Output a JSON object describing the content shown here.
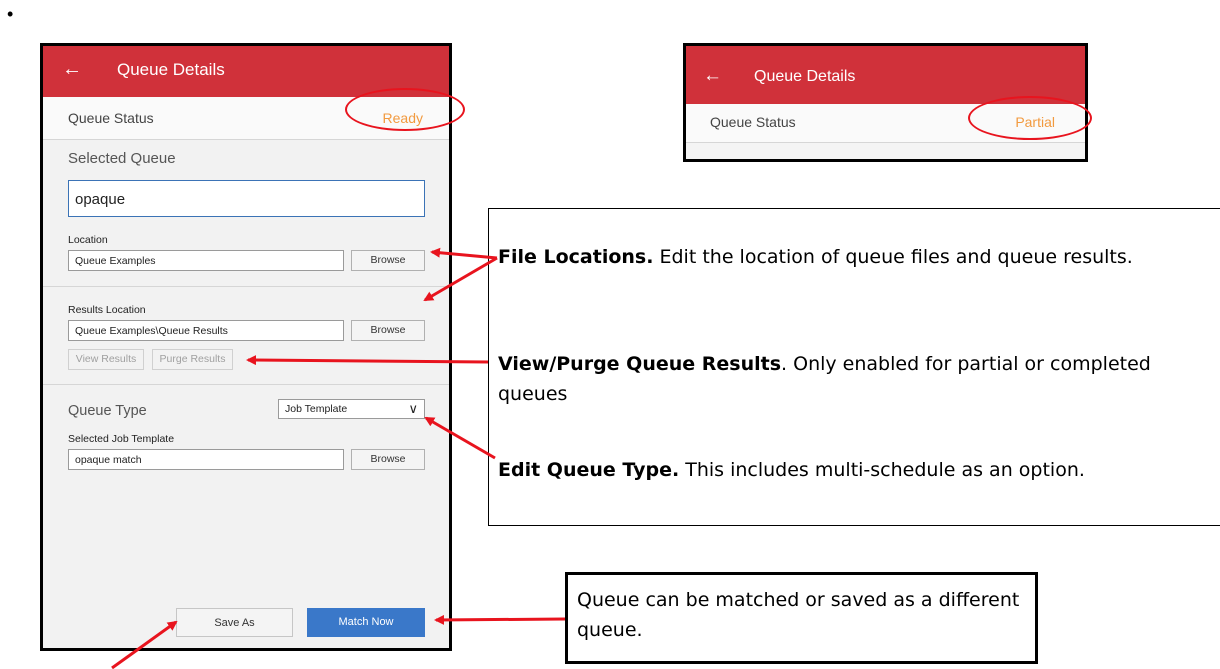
{
  "bullet": "•",
  "main_panel": {
    "header": {
      "back_icon": "arrow-left-icon",
      "back_glyph": "←",
      "title": "Queue Details"
    },
    "status": {
      "label": "Queue Status",
      "value": "Ready"
    },
    "selected_queue": {
      "label": "Selected Queue",
      "value": "opaque"
    },
    "location": {
      "label": "Location",
      "value": "Queue Examples",
      "browse": "Browse"
    },
    "results_location": {
      "label": "Results Location",
      "value": "Queue Examples\\Queue Results",
      "browse": "Browse"
    },
    "results_buttons": {
      "view": "View Results",
      "purge": "Purge Results"
    },
    "queue_type": {
      "label": "Queue Type",
      "selected": "Job Template",
      "chevron": "∨"
    },
    "job_template": {
      "label": "Selected Job Template",
      "value": "opaque match",
      "browse": "Browse"
    },
    "footer": {
      "save_as": "Save As",
      "match_now": "Match Now"
    }
  },
  "partial_panel": {
    "header": {
      "back_glyph": "←",
      "title": "Queue Details"
    },
    "status": {
      "label": "Queue Status",
      "value": "Partial"
    }
  },
  "callouts": {
    "file_locations": {
      "bold": "File Locations.",
      "text": "  Edit the location of queue files and queue results."
    },
    "view_purge": {
      "bold": "View/Purge Queue Results",
      "text": ". Only enabled for partial or completed queues"
    },
    "edit_type": {
      "bold": "Edit Queue Type.",
      "text": "  This includes multi-schedule as an option."
    },
    "match_save": {
      "text": "Queue can be matched or saved as a different queue."
    }
  },
  "colors": {
    "header_red": "#d0313a",
    "status_orange": "#f29a3f",
    "primary_blue": "#3a78c9",
    "annotation_red": "#e8141e"
  }
}
